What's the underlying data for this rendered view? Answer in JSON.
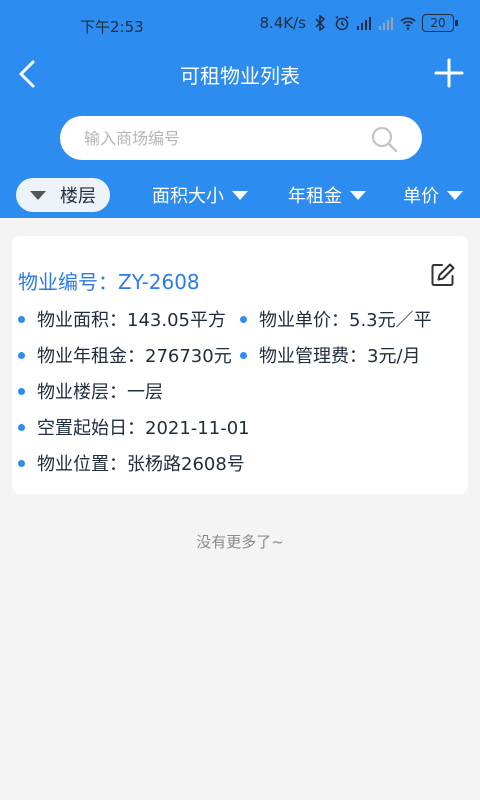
{
  "status_bar": {
    "time": "下午2:53",
    "network_speed": "8.4K/s",
    "battery": "20",
    "icons": [
      "bluetooth-icon",
      "alarm-icon",
      "hd-signal-icon",
      "signal-icon",
      "wifi-icon",
      "battery-icon"
    ]
  },
  "navbar": {
    "title": "可租物业列表",
    "back_icon": "chevron-left-icon",
    "add_icon": "plus-icon"
  },
  "search": {
    "placeholder": "输入商场编号",
    "value": ""
  },
  "filters": [
    {
      "label": "楼层",
      "active": true
    },
    {
      "label": "面积大小",
      "active": false
    },
    {
      "label": "年租金",
      "active": false
    },
    {
      "label": "单价",
      "active": false
    }
  ],
  "property_card": {
    "title": "物业编号：ZY-2608",
    "area": "物业面积：143.05平方",
    "unit_price": "物业单价：5.3元／平",
    "annual_rent": "物业年租金：276730元",
    "management_fee": "物业管理费：3元/月",
    "floor": "物业楼层：一层",
    "vacancy_start": "空置起始日：2021-11-01",
    "location": "物业位置：张杨路2608号"
  },
  "list_footer": "没有更多了~",
  "colors": {
    "primary": "#2d8cf0",
    "title_blue": "#2d7be5",
    "background": "#f4f4f4"
  }
}
